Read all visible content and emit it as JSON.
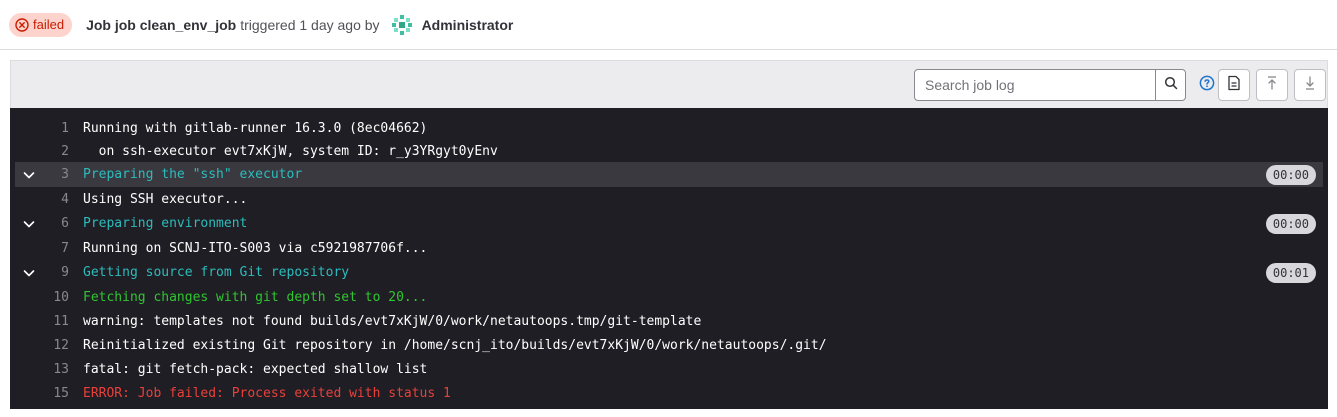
{
  "header": {
    "status_label": "failed",
    "status_icon": "status-failed-icon",
    "job_label": "Job job clean_env_job",
    "triggered_text": "triggered 1 day ago by",
    "user_name": "Administrator",
    "colors": {
      "failed_bg": "#fdd4cd",
      "failed_text": "#c91c00"
    }
  },
  "toolbar": {
    "search_placeholder": "Search job log",
    "search_value": "",
    "icons": [
      "search-icon",
      "help-icon",
      "raw-log-icon",
      "scroll-to-top-icon",
      "scroll-to-bottom-icon"
    ]
  },
  "log": {
    "lines": [
      {
        "num": "1",
        "text": "Running with gitlab-runner 16.3.0 (8ec04662)",
        "color": "white"
      },
      {
        "num": "2",
        "text": "  on ssh-executor evt7xKjW, system ID: r_y3YRgyt0yEnv",
        "color": "white"
      },
      {
        "num": "3",
        "text": "Preparing the \"ssh\" executor",
        "color": "cyan",
        "duration": "00:00"
      },
      {
        "num": "4",
        "text": "Using SSH executor...",
        "color": "white"
      },
      {
        "num": "6",
        "text": "Preparing environment",
        "color": "cyan",
        "duration": "00:00"
      },
      {
        "num": "7",
        "text": "Running on SCNJ-ITO-S003 via c5921987706f...",
        "color": "white"
      },
      {
        "num": "9",
        "text": "Getting source from Git repository",
        "color": "cyan",
        "duration": "00:01"
      },
      {
        "num": "10",
        "text": "Fetching changes with git depth set to 20...",
        "color": "green"
      },
      {
        "num": "11",
        "text": "warning: templates not found builds/evt7xKjW/0/work/netautoops.tmp/git-template",
        "color": "white"
      },
      {
        "num": "12",
        "text": "Reinitialized existing Git repository in /home/scnj_ito/builds/evt7xKjW/0/work/netautoops/.git/",
        "color": "white"
      },
      {
        "num": "13",
        "text": "fatal: git fetch-pack: expected shallow list",
        "color": "white"
      },
      {
        "num": "15",
        "text": "ERROR: Job failed: Process exited with status 1",
        "color": "red"
      }
    ]
  }
}
